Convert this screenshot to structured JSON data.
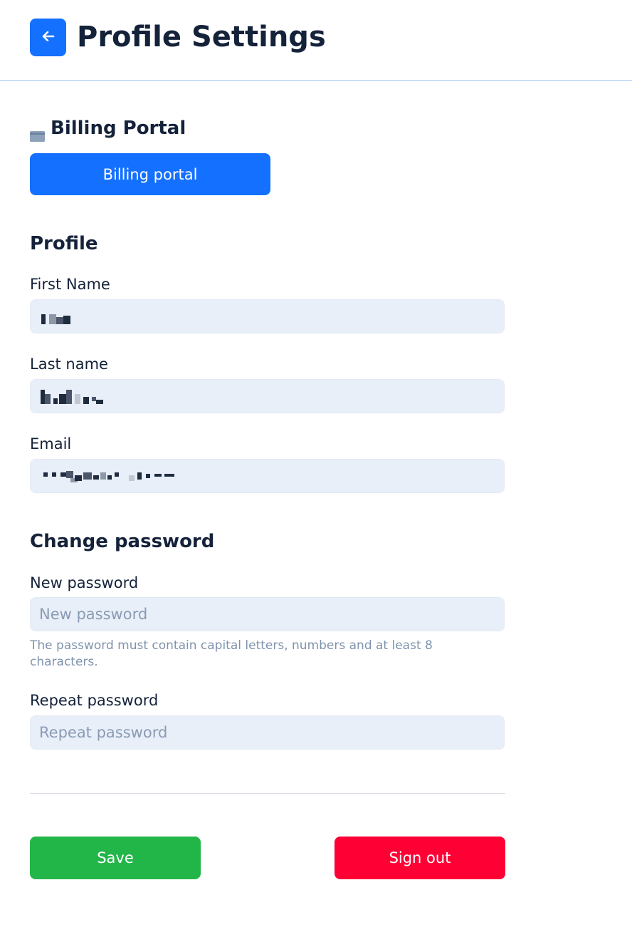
{
  "header": {
    "title": "Profile Settings",
    "back_icon": "arrow-left-icon"
  },
  "billing": {
    "heading": "Billing Portal",
    "icon": "credit-card-icon",
    "button_label": "Billing portal"
  },
  "profile": {
    "heading": "Profile",
    "first_name_label": "First Name",
    "last_name_label": "Last name",
    "email_label": "Email"
  },
  "password": {
    "heading": "Change password",
    "new_label": "New password",
    "new_placeholder": "New password",
    "hint": "The password must contain capital letters, numbers and at least 8 characters.",
    "repeat_label": "Repeat password",
    "repeat_placeholder": "Repeat password"
  },
  "actions": {
    "save_label": "Save",
    "signout_label": "Sign out"
  },
  "colors": {
    "primary": "#1470ff",
    "save": "#22b649",
    "signout": "#ff0035",
    "input_bg": "#e8eff8",
    "text": "#14223a"
  }
}
